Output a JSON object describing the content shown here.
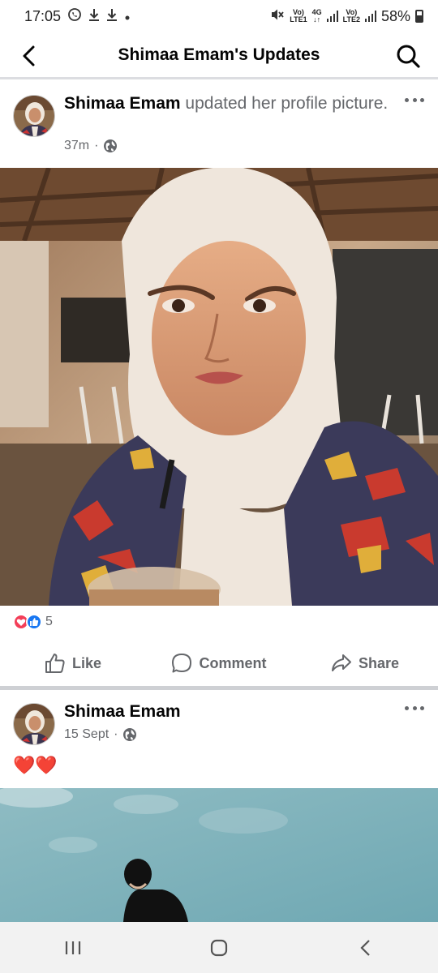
{
  "status_bar": {
    "time": "17:05",
    "battery": "58%",
    "sim1_label_top": "Vo)",
    "sim1_label_bottom": "LTE1",
    "net_label_top": "4G",
    "net_label_bottom": "↓↑",
    "sim2_label_top": "Vo)",
    "sim2_label_bottom": "LTE2",
    "icons": [
      "whatsapp-icon",
      "download-icon",
      "download-icon",
      "dot-icon",
      "mute-icon",
      "signal-icon",
      "battery-icon"
    ]
  },
  "header": {
    "title": "Shimaa Emam's Updates",
    "back_icon": "chevron-left-icon",
    "search_icon": "search-icon"
  },
  "posts": [
    {
      "author": "Shimaa Emam",
      "action": " updated her profile picture.",
      "time": "37m",
      "privacy_icon": "globe-icon",
      "reaction_count": "5",
      "reactions": [
        "love",
        "like"
      ]
    },
    {
      "author": "Shimaa Emam",
      "time": "15 Sept",
      "privacy_icon": "globe-icon",
      "caption": "❤️❤️"
    }
  ],
  "actions": {
    "like": "Like",
    "comment": "Comment",
    "share": "Share"
  },
  "colors": {
    "accent_blue": "#1877f2",
    "love_red": "#f33e58",
    "secondary_text": "#65676b",
    "divider": "#ced0d4"
  },
  "nav_bar": {
    "recents_icon": "recents-icon",
    "home_icon": "home-icon",
    "back_icon": "back-icon"
  }
}
